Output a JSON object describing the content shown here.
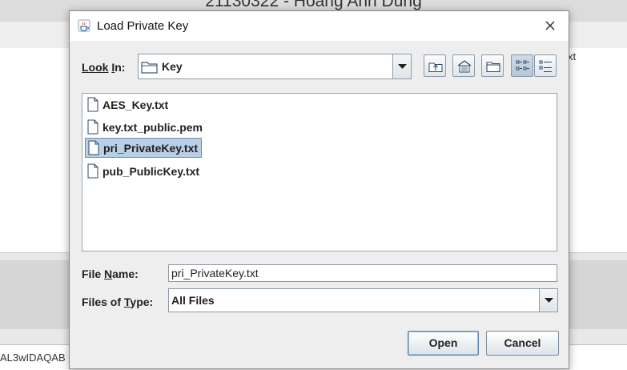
{
  "background": {
    "header_text": "21130322 - Hoang Anh Dung",
    "right_text": "xt",
    "bottom_text": "AL3wIDAQAB"
  },
  "dialog": {
    "title": "Load Private Key",
    "look_in_label": "Look In:",
    "look_in_value": "Key",
    "toolbar": [
      "up-one-level-icon",
      "home-icon",
      "new-folder-icon",
      "list-view-icon",
      "details-view-icon"
    ],
    "files": [
      "AES_Key.txt",
      "key.txt_public.pem",
      "pri_PrivateKey.txt",
      "pub_PublicKey.txt"
    ],
    "selected_file": "pri_PrivateKey.txt",
    "file_name_label": "File Name:",
    "file_name_value": "pri_PrivateKey.txt",
    "files_of_type_label": "Files of Type:",
    "files_of_type_value": "All Files",
    "open_label": "Open",
    "cancel_label": "Cancel"
  }
}
